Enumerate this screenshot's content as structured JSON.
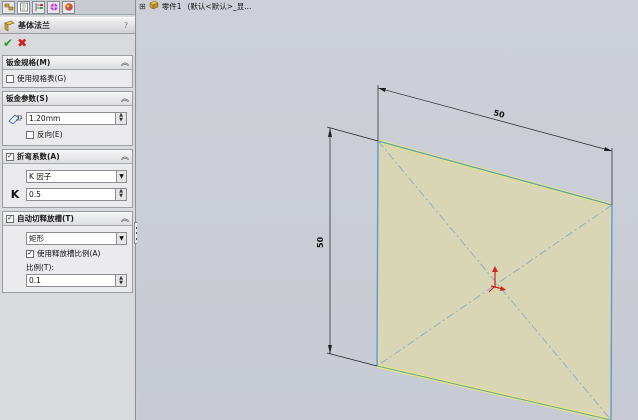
{
  "tabs": [
    "feature-manager-icon",
    "property-manager-icon",
    "configuration-manager-icon",
    "dimxpert-icon",
    "display-manager-icon"
  ],
  "feature": {
    "title": "基体法兰",
    "help": "?"
  },
  "sheet_metal_gauges": {
    "title": "钣金规格(M)",
    "use_gauge_table_label": "使用规格表(G)"
  },
  "sheet_metal_params": {
    "title": "钣金参数(S)",
    "thickness_value": "1.20mm",
    "reverse_label": "反向(E)"
  },
  "bend_allowance": {
    "title": "折弯系数(A)",
    "type_selected": "K 因子",
    "k_symbol": "K",
    "k_value": "0.5"
  },
  "auto_relief": {
    "title": "自动切释放槽(T)",
    "type_selected": "矩形",
    "use_ratio_label": "使用释放槽比例(A)",
    "ratio_label": "比例(T):",
    "ratio_value": "0.1"
  },
  "tree": {
    "part_name": "零件1",
    "config": "(默认<默认>_显..."
  },
  "dimensions": {
    "width": "50",
    "height": "50"
  },
  "colors": {
    "face_fill": "#d8d6b4",
    "edge_blue": "#5b9bd5",
    "edge_yellow": "#f1ec5c",
    "ok_green": "#2e9c2e",
    "cancel_red": "#d12020"
  }
}
